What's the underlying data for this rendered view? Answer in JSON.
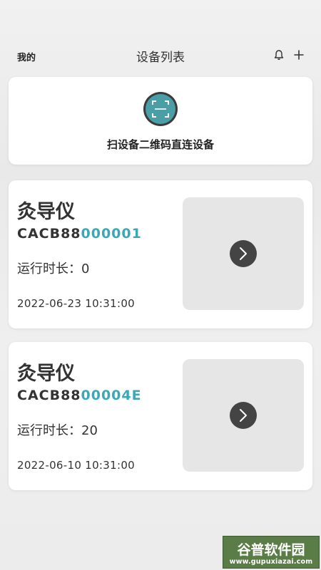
{
  "header": {
    "left_label": "我的",
    "title": "设备列表",
    "icons": [
      "bell-icon",
      "plus-icon"
    ]
  },
  "scan": {
    "icon": "qr-scan-icon",
    "label": "扫设备二维码直连设备",
    "accent_color": "#4a9fa6"
  },
  "devices": [
    {
      "name": "灸导仪",
      "code_prefix": "CACB88",
      "code_suffix": "000001",
      "runtime": "运行时长：0",
      "timestamp": "2022-06-23 10:31:00",
      "action_icon": "chevron-right-icon"
    },
    {
      "name": "灸导仪",
      "code_prefix": "CACB88",
      "code_suffix": "00004E",
      "runtime": "运行时长：20",
      "timestamp": "2022-06-10 10:31:00",
      "action_icon": "chevron-right-icon"
    }
  ],
  "watermark": {
    "text": "谷普软件园",
    "url": "www.gupuxiazai.com"
  },
  "colors": {
    "accent": "#3aa8b5",
    "card_bg": "#ffffff",
    "thumb_bg": "#e6e6e6",
    "arrow_circle": "#444444"
  }
}
